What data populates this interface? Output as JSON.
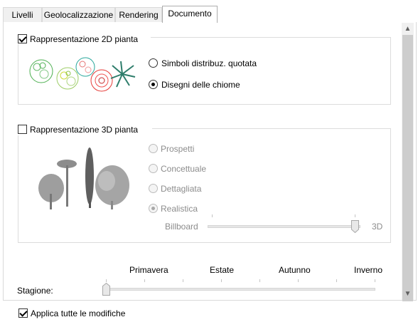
{
  "tabs": [
    {
      "label": "Livelli"
    },
    {
      "label": "Geolocalizzazione"
    },
    {
      "label": "Rendering"
    },
    {
      "label": "Documento"
    }
  ],
  "plan2d": {
    "label": "Rappresentazione 2D pianta",
    "checked": true,
    "options": [
      {
        "label": "Simboli distribuz. quotata",
        "selected": false
      },
      {
        "label": "Disegni delle chiome",
        "selected": true
      }
    ]
  },
  "plan3d": {
    "label": "Rappresentazione 3D pianta",
    "checked": false,
    "options": [
      {
        "label": "Prospetti",
        "selected": false
      },
      {
        "label": "Concettuale",
        "selected": false
      },
      {
        "label": "Dettagliata",
        "selected": false
      },
      {
        "label": "Realistica",
        "selected": true
      }
    ],
    "slider": {
      "min_label": "Billboard",
      "max_label": "3D",
      "value": 1.0
    }
  },
  "season": {
    "label": "Stagione:",
    "ticks": [
      "Primavera",
      "Estate",
      "Autunno",
      "Inverno"
    ],
    "value": 0.0
  },
  "apply_all": {
    "label": "Applica tutte le modifiche",
    "checked": true
  },
  "colors": {
    "accent": "#0078d7",
    "disabled": "#8c8c8c"
  }
}
